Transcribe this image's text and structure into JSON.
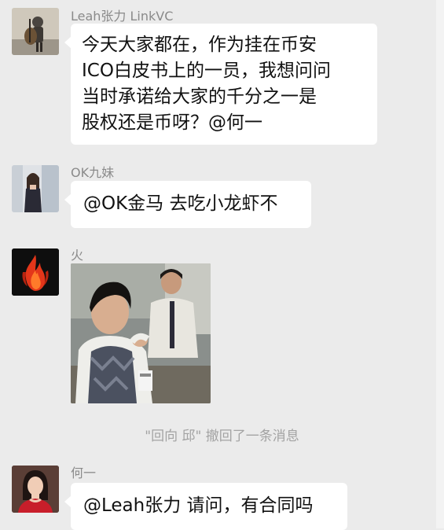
{
  "messages": [
    {
      "sender": "Leah张力 LinkVC",
      "text": "今天大家都在，作为挂在币安\nICO白皮书上的一员，我想问问\n当时承诺给大家的千分之一是\n股权还是币呀？@何一"
    },
    {
      "sender": "OK九妹",
      "text": "@OK金马 去吃小龙虾不"
    },
    {
      "sender": "火",
      "image": "meme-photo"
    },
    {
      "sender": "何一",
      "text": "@Leah张力 请问，有合同吗"
    }
  ],
  "system_notice": "\"回向 邱\" 撤回了一条消息",
  "colors": {
    "background": "#ebebeb",
    "bubble": "#ffffff",
    "sender_name": "#8a8a8a",
    "system_text": "#a3a3a3"
  },
  "icons": [
    "avatar-leah",
    "avatar-ok-jiumei",
    "avatar-fire",
    "avatar-he-yi"
  ]
}
